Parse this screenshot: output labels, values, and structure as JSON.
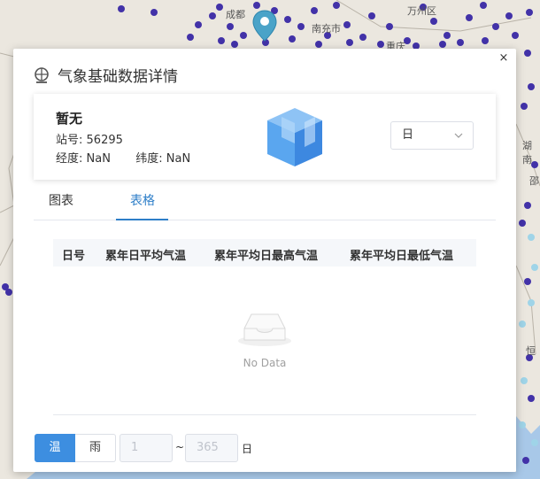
{
  "map": {
    "labels": [
      "成都",
      "南充市",
      "万州区",
      "重庆",
      "湖南",
      "邵",
      "恒"
    ]
  },
  "dialog": {
    "close_label": "×",
    "title": "气象基础数据详情",
    "station": {
      "name": "暂无",
      "id_label": "站号:",
      "id_value": "56295",
      "lon_label": "经度:",
      "lon_value": "NaN",
      "lat_label": "纬度:",
      "lat_value": "NaN"
    },
    "period_select": {
      "value": "日"
    },
    "tabs": [
      {
        "label": "图表",
        "active": false
      },
      {
        "label": "表格",
        "active": true
      }
    ],
    "table": {
      "columns": [
        "日号",
        "累年日平均气温",
        "累年平均日最高气温",
        "累年平均日最低气温"
      ],
      "rows": [],
      "empty_text": "No Data"
    },
    "toggle": {
      "temperature": "温",
      "rain": "雨",
      "active": "温"
    },
    "range": {
      "start": "1",
      "end": "365",
      "separator": "~",
      "unit": "日"
    }
  },
  "colors": {
    "accent": "#3d8ee0",
    "tab_active": "#2d7ec8",
    "map_dot": "#4232a8"
  }
}
